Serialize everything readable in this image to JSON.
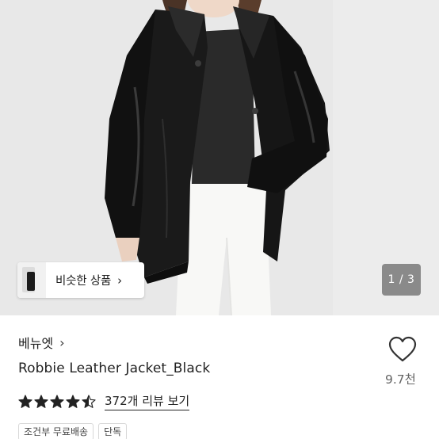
{
  "gallery": {
    "similar_button_label": "비슷한 상품",
    "similar_chevron": "›",
    "page_indicator": "1 / 3"
  },
  "product": {
    "store_name": "베뉴엣",
    "store_chevron": "›",
    "title": "Robbie Leather Jacket_Black",
    "like_count": "9.7천",
    "rating_value": 4.5,
    "rating_max": 5,
    "review_link": "372개 리뷰 보기",
    "tags": [
      "조건부 무료배송",
      "단독"
    ]
  },
  "colors": {
    "hero_background": "#e9e9e9",
    "text_primary": "#222222",
    "text_secondary": "#666666",
    "star": "#222222"
  },
  "icons": {
    "heart": "heart-outline-icon",
    "star": "star-icon",
    "chevron": "chevron-right-icon"
  }
}
